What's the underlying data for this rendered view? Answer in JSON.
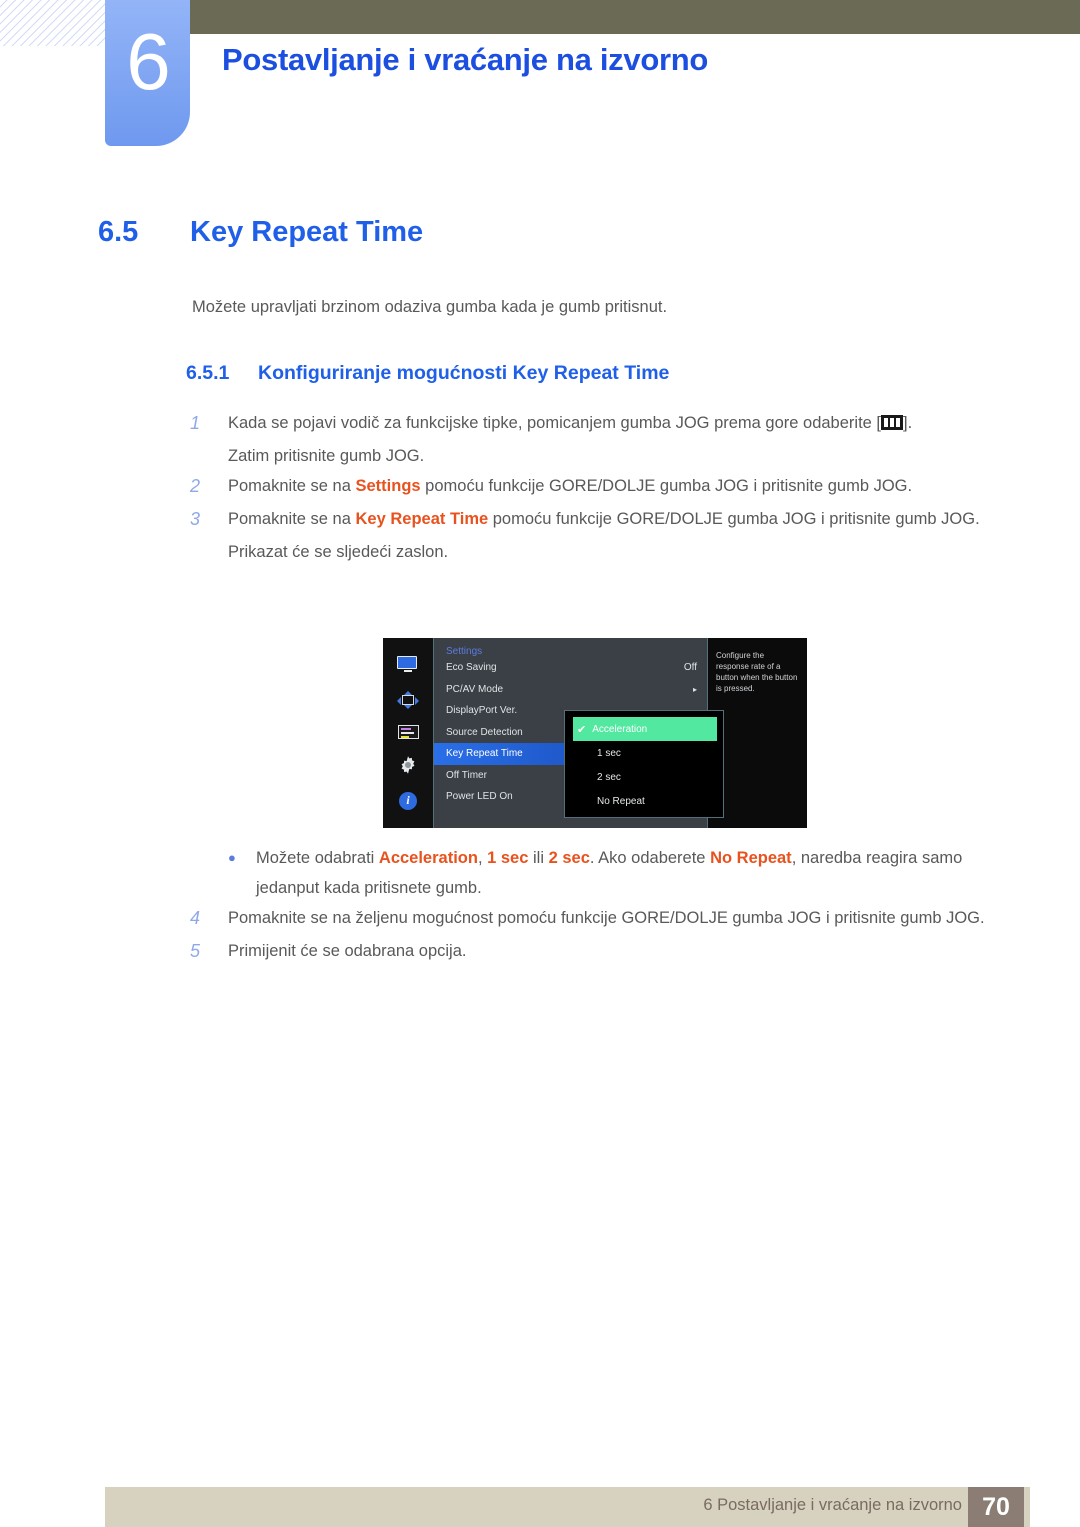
{
  "header": {
    "chapter_number": "6",
    "chapter_title": "Postavljanje i vraćanje na izvorno"
  },
  "section": {
    "number": "6.5",
    "title": "Key Repeat Time",
    "intro": "Možete upravljati brzinom odaziva gumba kada je gumb pritisnut.",
    "sub_number": "6.5.1",
    "sub_title": "Konfiguriranje mogućnosti Key Repeat Time"
  },
  "steps": [
    {
      "num": "1",
      "pre": "Kada se pojavi vodič za funkcijske tipke, pomicanjem gumba JOG prema gore odaberite [",
      "post": "].",
      "extra": "Zatim pritisnite gumb JOG."
    },
    {
      "num": "2",
      "pre": "Pomaknite se na ",
      "highlight": "Settings",
      "post": " pomoću funkcije GORE/DOLJE gumba JOG i pritisnite gumb JOG."
    },
    {
      "num": "3",
      "pre": "Pomaknite se na ",
      "highlight": "Key Repeat Time",
      "post": " pomoću funkcije GORE/DOLJE gumba JOG i pritisnite gumb JOG.",
      "extra": "Prikazat će se sljedeći zaslon."
    }
  ],
  "steps2": [
    {
      "num": "4",
      "text": "Pomaknite se na željenu mogućnost pomoću funkcije GORE/DOLJE gumba JOG i pritisnite gumb JOG."
    },
    {
      "num": "5",
      "text": "Primijenit će se odabrana opcija."
    }
  ],
  "bullet": {
    "marker": "●",
    "t1": "Možete odabrati ",
    "h1": "Acceleration",
    "t2": ", ",
    "h2": "1 sec",
    "t3": " ili ",
    "h3": "2 sec",
    "t4": ". Ako odaberete ",
    "h4": "No Repeat",
    "t5": ", naredba reagira samo jedanput kada pritisnete gumb."
  },
  "osd": {
    "title": "Settings",
    "rows": [
      {
        "label": "Eco Saving",
        "value": "Off"
      },
      {
        "label": "PC/AV Mode",
        "value": "▸"
      },
      {
        "label": "DisplayPort Ver.",
        "value": ""
      },
      {
        "label": "Source Detection",
        "value": ""
      },
      {
        "label": "Key Repeat Time",
        "value": "",
        "selected": true
      },
      {
        "label": "Off Timer",
        "value": ""
      },
      {
        "label": "Power LED On",
        "value": ""
      }
    ],
    "options": [
      {
        "label": "Acceleration",
        "active": true,
        "check": "✔"
      },
      {
        "label": "1 sec",
        "active": false
      },
      {
        "label": "2 sec",
        "active": false
      },
      {
        "label": "No Repeat",
        "active": false
      }
    ],
    "help": "Configure the response rate of a button when the button is pressed.",
    "icons": [
      "monitor-icon",
      "move-arrows-icon",
      "picture-lines-icon",
      "gear-icon",
      "info-icon"
    ]
  },
  "footer": {
    "text": "6 Postavljanje i vraćanje na izvorno",
    "page": "70"
  },
  "colors": {
    "accent_blue": "#2060e8",
    "highlight_orange": "#e8521e",
    "olive": "#6b6a54",
    "footer_beige": "#d7d2bf",
    "osd_green": "#52e8a0"
  }
}
